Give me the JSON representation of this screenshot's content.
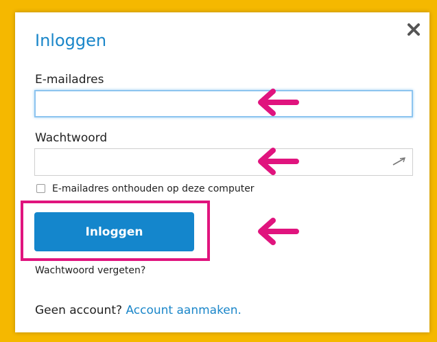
{
  "colors": {
    "background": "#f5b800",
    "accent": "#1a86c9",
    "button": "#1486cc",
    "annotation": "#e0147e"
  },
  "dialog": {
    "title": "Inloggen",
    "close_icon": "close-icon"
  },
  "email": {
    "label": "E-mailadres",
    "value": "",
    "placeholder": ""
  },
  "password": {
    "label": "Wachtwoord",
    "value": "",
    "placeholder": "",
    "icon": "key-icon"
  },
  "remember": {
    "label": "E-mailadres onthouden op deze computer",
    "checked": false
  },
  "login_button": {
    "label": "Inloggen"
  },
  "forgot_link": "Wachtwoord vergeten?",
  "no_account": {
    "text": "Geen account?",
    "link": "Account aanmaken."
  },
  "annotations": {
    "arrow_icon": "arrow-left-icon",
    "highlight": "highlight-rectangle"
  }
}
